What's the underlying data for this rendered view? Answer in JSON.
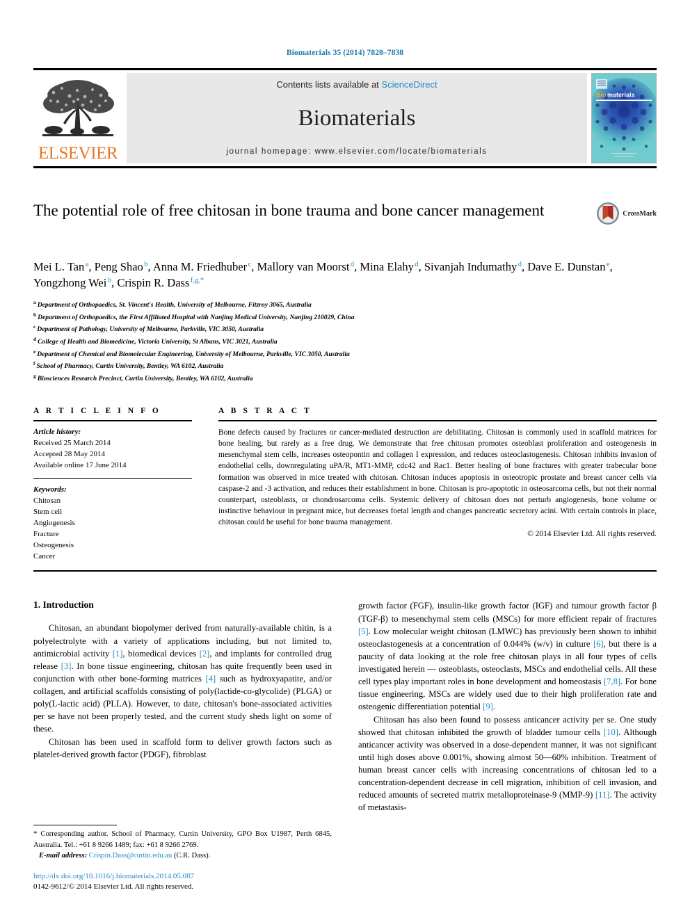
{
  "running_head": "Biomaterials 35 (2014) 7828–7838",
  "header": {
    "contents_prefix": "Contents lists available at ",
    "sciencedirect": "ScienceDirect",
    "journal_name": "Biomaterials",
    "homepage": "journal homepage: www.elsevier.com/locate/biomaterials",
    "publisher_logo_text": "ELSEVIER",
    "cover_title_bio": "Bio",
    "cover_title_materials": "materials"
  },
  "article": {
    "title": "The potential role of free chitosan in bone trauma and bone cancer management",
    "crossmark_label": "CrossMark",
    "authors": [
      {
        "name": "Mei L. Tan",
        "marks": "a"
      },
      {
        "name": "Peng Shao",
        "marks": "b"
      },
      {
        "name": "Anna M. Friedhuber",
        "marks": "c"
      },
      {
        "name": "Mallory van Moorst",
        "marks": "d"
      },
      {
        "name": "Mina Elahy",
        "marks": "d"
      },
      {
        "name": "Sivanjah Indumathy",
        "marks": "d"
      },
      {
        "name": "Dave E. Dunstan",
        "marks": "e"
      },
      {
        "name": "Yongzhong Wei",
        "marks": "b"
      },
      {
        "name": "Crispin R. Dass",
        "marks": "f,g,*"
      }
    ],
    "affiliations": [
      {
        "mark": "a",
        "text": "Department of Orthopaedics, St. Vincent's Health, University of Melbourne, Fitzroy 3065, Australia"
      },
      {
        "mark": "b",
        "text": "Department of Orthopaedics, the First Affiliated Hospital with Nanjing Medical University, Nanjing 210029, China"
      },
      {
        "mark": "c",
        "text": "Department of Pathology, University of Melbourne, Parkville, VIC 3050, Australia"
      },
      {
        "mark": "d",
        "text": "College of Health and Biomedicine, Victoria University, St Albans, VIC 3021, Australia"
      },
      {
        "mark": "e",
        "text": "Department of Chemical and Biomolecular Engineering, University of Melbourne, Parkville, VIC 3050, Australia"
      },
      {
        "mark": "f",
        "text": "School of Pharmacy, Curtin University, Bentley, WA 6102, Australia"
      },
      {
        "mark": "g",
        "text": "Biosciences Research Precinct, Curtin University, Bentley, WA 6102, Australia"
      }
    ]
  },
  "article_info": {
    "heading": "A R T I C L E  I N F O",
    "history_label": "Article history:",
    "history": [
      "Received 25 March 2014",
      "Accepted 28 May 2014",
      "Available online 17 June 2014"
    ],
    "keywords_label": "Keywords:",
    "keywords": [
      "Chitosan",
      "Stem cell",
      "Angiogenesis",
      "Fracture",
      "Osteogenesis",
      "Cancer"
    ]
  },
  "abstract": {
    "heading": "A B S T R A C T",
    "text": "Bone defects caused by fractures or cancer-mediated destruction are debilitating. Chitosan is commonly used in scaffold matrices for bone healing, but rarely as a free drug. We demonstrate that free chitosan promotes osteoblast proliferation and osteogenesis in mesenchymal stem cells, increases osteopontin and collagen I expression, and reduces osteoclastogenesis. Chitosan inhibits invasion of endothelial cells, downregulating uPA/R, MT1-MMP, cdc42 and Rac1. Better healing of bone fractures with greater trabecular bone formation was observed in mice treated with chitosan. Chitosan induces apoptosis in osteotropic prostate and breast cancer cells via caspase-2 and -3 activation, and reduces their establishment in bone. Chitosan is pro-apoptotic in osteosarcoma cells, but not their normal counterpart, osteoblasts, or chondrosarcoma cells. Systemic delivery of chitosan does not perturb angiogenesis, bone volume or instinctive behaviour in pregnant mice, but decreases foetal length and changes pancreatic secretory acini. With certain controls in place, chitosan could be useful for bone trauma management.",
    "copyright": "© 2014 Elsevier Ltd. All rights reserved."
  },
  "introduction": {
    "section_title": "1. Introduction",
    "left_paragraphs": [
      "Chitosan, an abundant biopolymer derived from naturally-available chitin, is a polyelectrolyte with a variety of applications including, but not limited to, antimicrobial activity [1], biomedical devices [2], and implants for controlled drug release [3]. In bone tissue engineering, chitosan has quite frequently been used in conjunction with other bone-forming matrices [4] such as hydroxyapatite, and/or collagen, and artificial scaffolds consisting of poly(lactide-co-glycolide) (PLGA) or poly(L-lactic acid) (PLLA). However, to date, chitosan's bone-associated activities per se have not been properly tested, and the current study sheds light on some of these.",
      "Chitosan has been used in scaffold form to deliver growth factors such as platelet-derived growth factor (PDGF), fibroblast"
    ],
    "right_paragraphs": [
      "growth factor (FGF), insulin-like growth factor (IGF) and tumour growth factor β (TGF-β) to mesenchymal stem cells (MSCs) for more efficient repair of fractures [5]. Low molecular weight chitosan (LMWC) has previously been shown to inhibit osteoclastogenesis at a concentration of 0.044% (w/v) in culture [6], but there is a paucity of data looking at the role free chitosan plays in all four types of cells investigated herein — osteoblasts, osteoclasts, MSCs and endothelial cells. All these cell types play important roles in bone development and homeostasis [7,8]. For bone tissue engineering, MSCs are widely used due to their high proliferation rate and osteogenic differentiation potential [9].",
      "Chitosan has also been found to possess anticancer activity per se. One study showed that chitosan inhibited the growth of bladder tumour cells [10]. Although anticancer activity was observed in a dose-dependent manner, it was not significant until high doses above 0.001%, showing almost 50—60% inhibition. Treatment of human breast cancer cells with increasing concentrations of chitosan led to a concentration-dependent decrease in cell migration, inhibition of cell invasion, and reduced amounts of secreted matrix metalloproteinase-9 (MMP-9) [11]. The activity of metastasis-"
    ]
  },
  "footnote": {
    "star": "*",
    "corresponding": "Corresponding author. School of Pharmacy, Curtin University, GPO Box U1987, Perth 6845, Australia. Tel.: +61 8 9266 1489; fax: +61 8 9266 2769.",
    "email_label": "E-mail address:",
    "email": "Crispin.Dass@curtin.edu.au",
    "email_owner": "(C.R. Dass).",
    "doi": "http://dx.doi.org/10.1016/j.biomaterials.2014.05.087",
    "issn_line": "0142-9612/© 2014 Elsevier Ltd. All rights reserved."
  },
  "colors": {
    "link": "#1f8ac0",
    "elsevier_orange": "#E87722",
    "header_band_bg": "#e8e8e8",
    "cover_teal": "#63c3c8",
    "cover_blue": "#2a3f9d"
  }
}
